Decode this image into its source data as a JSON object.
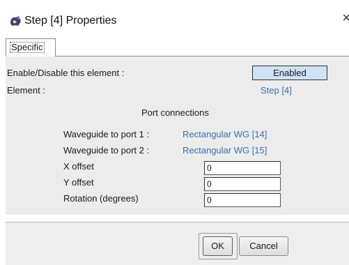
{
  "window": {
    "title": "Step [4] Properties",
    "close_glyph": "×",
    "icon": "app-gear-icon"
  },
  "tabs": [
    {
      "label": "Specific",
      "active": true
    }
  ],
  "specific": {
    "enable_label": "Enable/Disable this element :",
    "enable_value": "Enabled",
    "element_label": "Element :",
    "element_value": "Step [4]",
    "port_heading": "Port connections",
    "port1_label": "Waveguide to port 1 :",
    "port1_value": "Rectangular WG [14]",
    "port2_label": "Waveguide to port 2 :",
    "port2_value": "Rectangular WG [15]",
    "x_offset_label": "X offset",
    "x_offset_value": "0",
    "y_offset_label": "Y offset",
    "y_offset_value": "0",
    "rotation_label": "Rotation (degrees)",
    "rotation_value": "0"
  },
  "buttons": {
    "ok_label": "OK",
    "cancel_label": "Cancel"
  },
  "colors": {
    "link": "#3b6fb0",
    "enabled_bg": "#cfe3f6",
    "panel_bg": "#ececec"
  }
}
